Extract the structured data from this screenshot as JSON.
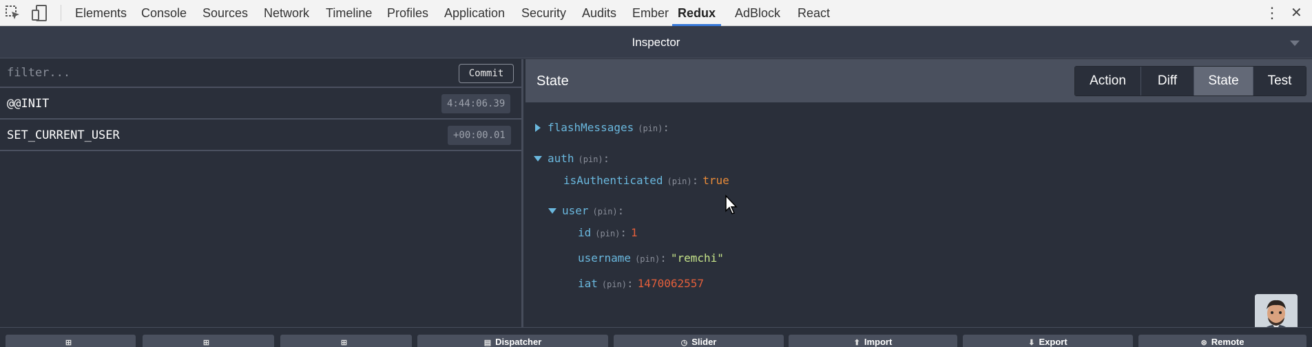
{
  "devtools": {
    "tabs": [
      "Elements",
      "Console",
      "Sources",
      "Network",
      "Timeline",
      "Profiles",
      "Application",
      "Security",
      "Audits",
      "Ember",
      "Redux",
      "AdBlock",
      "React"
    ],
    "active_tab": "Redux",
    "menu_icon": "⋮",
    "close_icon": "✕"
  },
  "inspector": {
    "title": "Inspector"
  },
  "action_list": {
    "filter_placeholder": "filter...",
    "commit_label": "Commit",
    "actions": [
      {
        "name": "@@INIT",
        "time": "4:44:06.39"
      },
      {
        "name": "SET_CURRENT_USER",
        "time": "+00:00.01"
      }
    ]
  },
  "state_panel": {
    "title": "State",
    "tabs": [
      "Action",
      "Diff",
      "State",
      "Test"
    ],
    "active_tab": "State",
    "tree": {
      "flashMessages": {
        "key": "flashMessages",
        "pin": "(pin)",
        "colon": ":"
      },
      "auth": {
        "key": "auth",
        "pin": "(pin)",
        "colon": ":"
      },
      "isAuthenticated": {
        "key": "isAuthenticated",
        "pin": "(pin)",
        "colon": ":",
        "value": "true"
      },
      "user": {
        "key": "user",
        "pin": "(pin)",
        "colon": ":"
      },
      "id": {
        "key": "id",
        "pin": "(pin)",
        "colon": ":",
        "value": "1"
      },
      "username": {
        "key": "username",
        "pin": "(pin)",
        "colon": ":",
        "value": "\"remchi\""
      },
      "iat": {
        "key": "iat",
        "pin": "(pin)",
        "colon": ":",
        "value": "1470062557"
      }
    }
  },
  "bottom_bar": {
    "buttons": [
      {
        "icon": "⊞",
        "label": ""
      },
      {
        "icon": "⊞",
        "label": ""
      },
      {
        "icon": "⊞",
        "label": ""
      },
      {
        "icon": "▤",
        "label": "Dispatcher"
      },
      {
        "icon": "◷",
        "label": "Slider"
      },
      {
        "icon": "⬆",
        "label": "Import"
      },
      {
        "icon": "⬇",
        "label": "Export"
      },
      {
        "icon": "⊛",
        "label": "Remote"
      }
    ]
  },
  "colors": {
    "accent_tab": "#3879d9",
    "key": "#6ab8de",
    "bool": "#e98b39",
    "number": "#e45f3b",
    "string": "#c7e58a"
  }
}
